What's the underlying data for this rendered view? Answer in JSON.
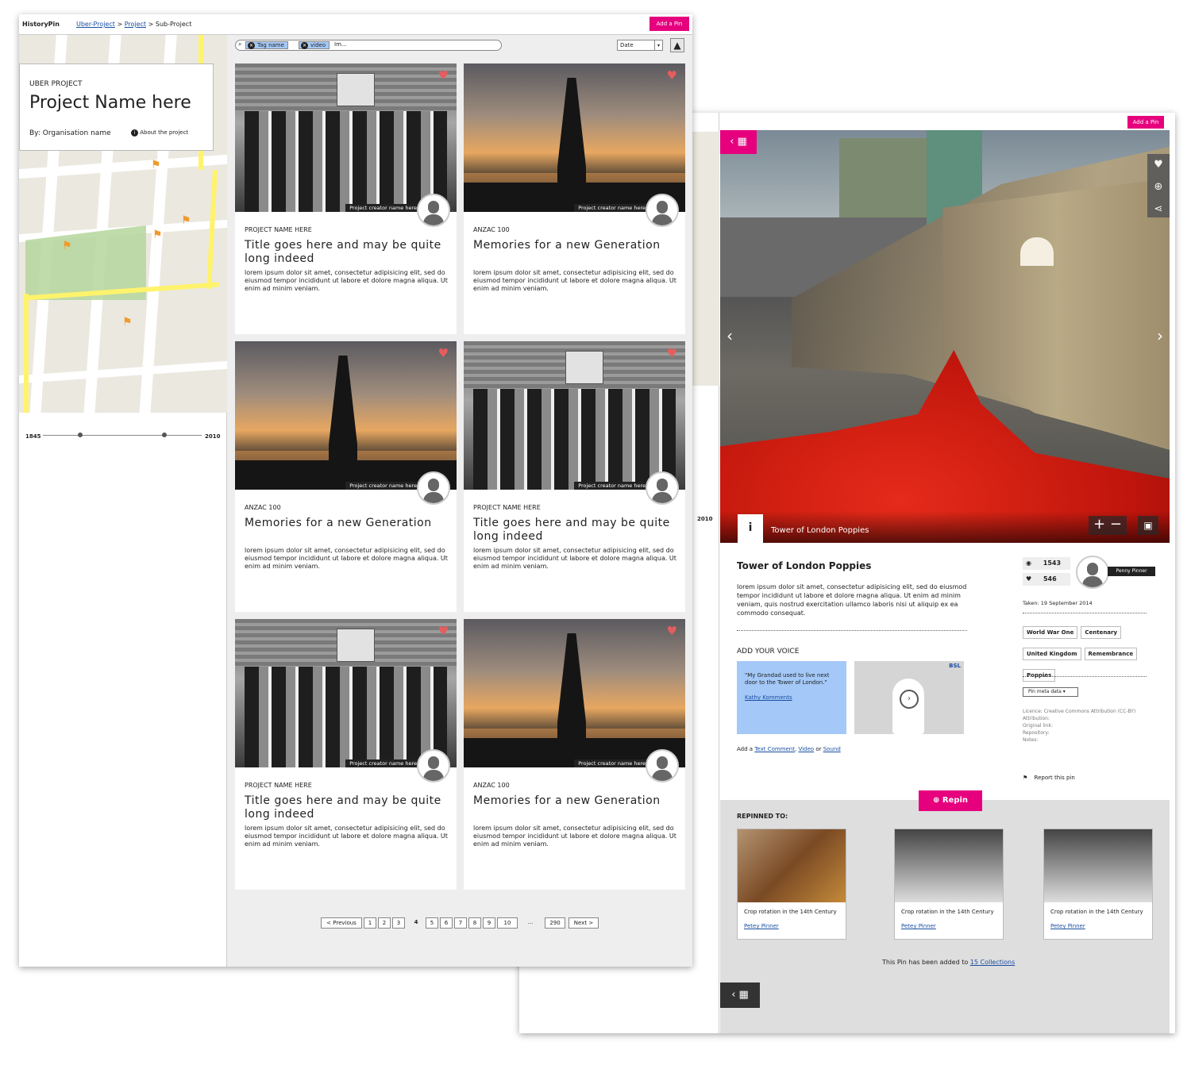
{
  "detail": {
    "add_pin": "Add a Pin",
    "timeline_end": "2010",
    "hero_caption": "Tower of London Poppies",
    "title": "Tower of London Poppies",
    "description": "lorem ipsum dolor sit amet, consectetur adipisicing elit, sed do eiusmod tempor incididunt ut labore et dolore magna aliqua. Ut enim ad minim veniam, quis nostrud exercitation ullamco laboris nisi ut aliquip ex ea commodo consequat.",
    "add_your_voice": "ADD YOUR VOICE",
    "quote": "\"My Grandad used to live next door to the Tower of London.\"",
    "quote_author": "Kathy Komments",
    "bsl": "BSL",
    "add_a": "Add a",
    "text_comment": "Text Comment",
    "video": "Video",
    "or": "or",
    "sound": "Sound",
    "views": "1543",
    "likes": "546",
    "pinner": "Penny Pinner",
    "taken_label": "Taken:",
    "taken_date": "19 September 2014",
    "tags": [
      "World War One",
      "Centenary",
      "United Kingdom",
      "Remembrance",
      "Poppies"
    ],
    "meta_select": "Pin meta data",
    "licence": "Licence: Creative Commons Attribution (CC-BY)",
    "attribution": "Attribution:",
    "original_link": "Original link:",
    "repository": "Repository:",
    "notes": "Notes:",
    "report": "Report this pin",
    "repin": "Repin",
    "repinned_to": "REPINNED TO:",
    "repins": [
      {
        "caption": "Crop rotation in the 14th Century",
        "by": "Petey Pinner"
      },
      {
        "caption": "Crop rotation in the 14th Century",
        "by": "Petey Pinner"
      },
      {
        "caption": "Crop rotation in the 14th Century",
        "by": "Petey Pinner"
      }
    ],
    "added_text": "This Pin has been added to",
    "added_link": "15 Collections"
  },
  "front": {
    "logo": "HistoryPin",
    "crumb1": "Uber-Project",
    "crumb2": "Project",
    "crumb3": "Sub-Project",
    "sep": ">",
    "add_pin": "Add a Pin",
    "uber_label": "UBER PROJECT",
    "project_name": "Project Name here",
    "by": "By: Organisation name",
    "about": "About the project",
    "timeline_start": "1845",
    "timeline_end": "2010",
    "chip1": "Tag name",
    "chip2": "video",
    "search_value": "Im...",
    "sort": "Date",
    "creator": "Project creator name here",
    "cards": [
      {
        "type": "PROJECT NAME HERE",
        "title": "Title goes here and may be quite long indeed",
        "body": "lorem ipsum dolor sit amet, consectetur adipisicing elit, sed do eiusmod tempor incididunt ut labore et dolore magna aliqua. Ut enim ad minim veniam."
      },
      {
        "type": "ANZAC 100",
        "title": "Memories for a new Generation",
        "body": "lorem ipsum dolor sit amet, consectetur adipisicing elit, sed do eiusmod tempor incididunt ut labore et dolore magna aliqua. Ut enim ad minim veniam."
      },
      {
        "type": "ANZAC 100",
        "title": "Memories for a new Generation",
        "body": "lorem ipsum dolor sit amet, consectetur adipisicing elit, sed do eiusmod tempor incididunt ut labore et dolore magna aliqua. Ut enim ad minim veniam."
      },
      {
        "type": "PROJECT NAME HERE",
        "title": "Title goes here and may be quite long indeed",
        "body": "lorem ipsum dolor sit amet, consectetur adipisicing elit, sed do eiusmod tempor incididunt ut labore et dolore magna aliqua. Ut enim ad minim veniam."
      },
      {
        "type": "PROJECT NAME HERE",
        "title": "Title goes here and may be quite long indeed",
        "body": "lorem ipsum dolor sit amet, consectetur adipisicing elit, sed do eiusmod tempor incididunt ut labore et dolore magna aliqua. Ut enim ad minim veniam."
      },
      {
        "type": "ANZAC 100",
        "title": "Memories for a new Generation",
        "body": "lorem ipsum dolor sit amet, consectetur adipisicing elit, sed do eiusmod tempor incididunt ut labore et dolore magna aliqua. Ut enim ad minim veniam."
      }
    ],
    "pager": {
      "prev": "< Previous",
      "pages": [
        "1",
        "2",
        "3"
      ],
      "current": "4",
      "pages_after": [
        "5",
        "6",
        "7",
        "8",
        "9",
        "10"
      ],
      "ellipsis": "...",
      "last": "290",
      "next": "Next >"
    }
  },
  "colors": {
    "accent": "#e6007e",
    "heart": "#e55d5d",
    "link": "#1a4fa3"
  }
}
